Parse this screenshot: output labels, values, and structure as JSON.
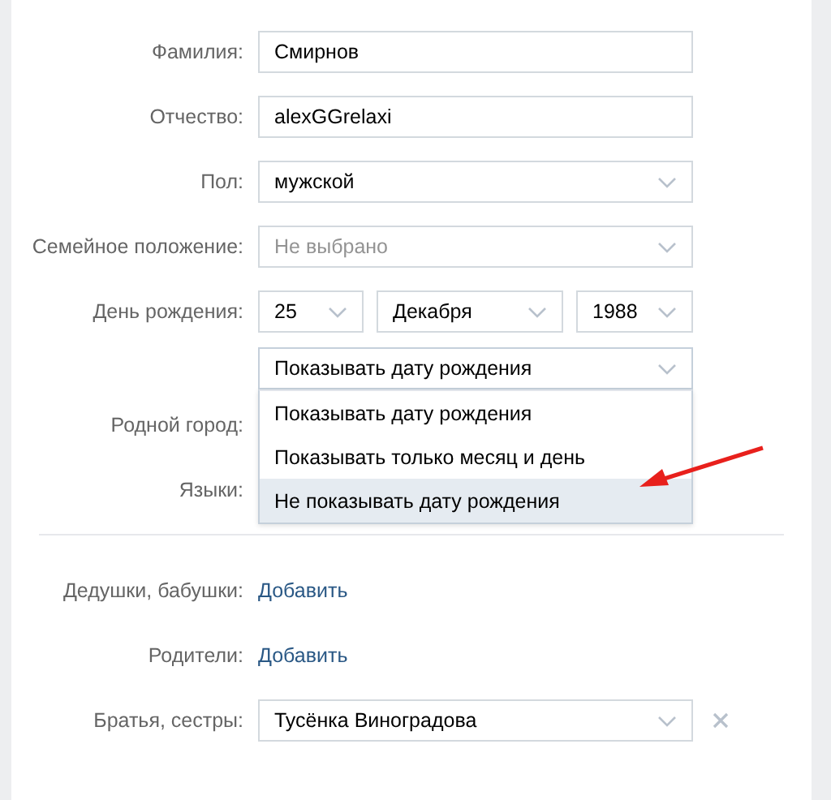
{
  "form": {
    "rows": [
      {
        "kind": "text",
        "label": "Фамилия:",
        "value": "Смирнов"
      },
      {
        "kind": "text",
        "label": "Отчество:",
        "value": "alexGGrelaxi"
      },
      {
        "kind": "select",
        "label": "Пол:",
        "value": "мужской"
      },
      {
        "kind": "select",
        "label": "Семейное положение:",
        "placeholder": "Не выбрано"
      },
      {
        "kind": "date",
        "label": "День рождения:",
        "parts": [
          "25",
          "Декабря",
          "1988"
        ]
      },
      {
        "kind": "visibility",
        "value": "Показывать дату рождения",
        "expanded": true,
        "options": [
          {
            "label": "Показывать дату рождения",
            "highlighted": false
          },
          {
            "label": "Показывать только месяц и день",
            "highlighted": false
          },
          {
            "label": "Не показывать дату рождения",
            "highlighted": true
          }
        ]
      },
      {
        "kind": "covered",
        "label": "Родной город:"
      },
      {
        "kind": "covered",
        "label": "Языки:"
      },
      {
        "kind": "divider"
      },
      {
        "kind": "link",
        "label": "Дедушки, бабушки:",
        "value": "Добавить"
      },
      {
        "kind": "link",
        "label": "Родители:",
        "value": "Добавить"
      },
      {
        "kind": "removable",
        "label": "Братья, сестры:",
        "value": "Тусёнка Виноградова"
      }
    ]
  }
}
